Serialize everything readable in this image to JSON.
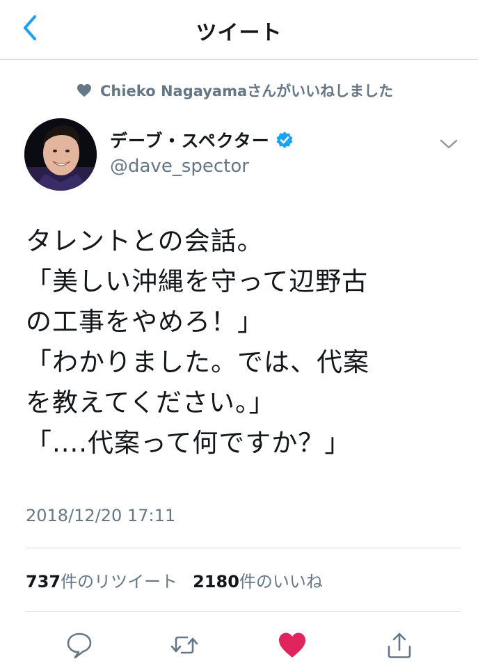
{
  "header": {
    "title": "ツイート",
    "back_icon": "chevron-left-icon"
  },
  "social_context": {
    "icon": "heart-icon",
    "text": "Chieko Nagayamaさんがいいねしました"
  },
  "author": {
    "display_name": "デーブ・スペクター",
    "handle": "@dave_spector",
    "verified": true,
    "verified_color": "#1da1f2"
  },
  "tweet": {
    "lines": [
      "タレントとの会話。",
      "「美しい沖縄を守って辺野古",
      "の工事をやめろ！」",
      "「わかりました。では、代案",
      "を教えてください。」",
      "「....代案って何ですか？」"
    ],
    "timestamp": "2018/12/20 17:11"
  },
  "stats": {
    "retweets_count": "737",
    "retweets_label": "件のリツイート",
    "likes_count": "2180",
    "likes_label": "件のいいね"
  },
  "actions": [
    {
      "name": "reply",
      "icon": "reply-icon"
    },
    {
      "name": "retweet",
      "icon": "retweet-icon"
    },
    {
      "name": "like",
      "icon": "heart-icon",
      "active": true,
      "color": "#e0245e"
    },
    {
      "name": "share",
      "icon": "share-icon"
    }
  ],
  "colors": {
    "accent": "#1da1f2",
    "secondary_text": "#657786",
    "like_active": "#e0245e"
  }
}
